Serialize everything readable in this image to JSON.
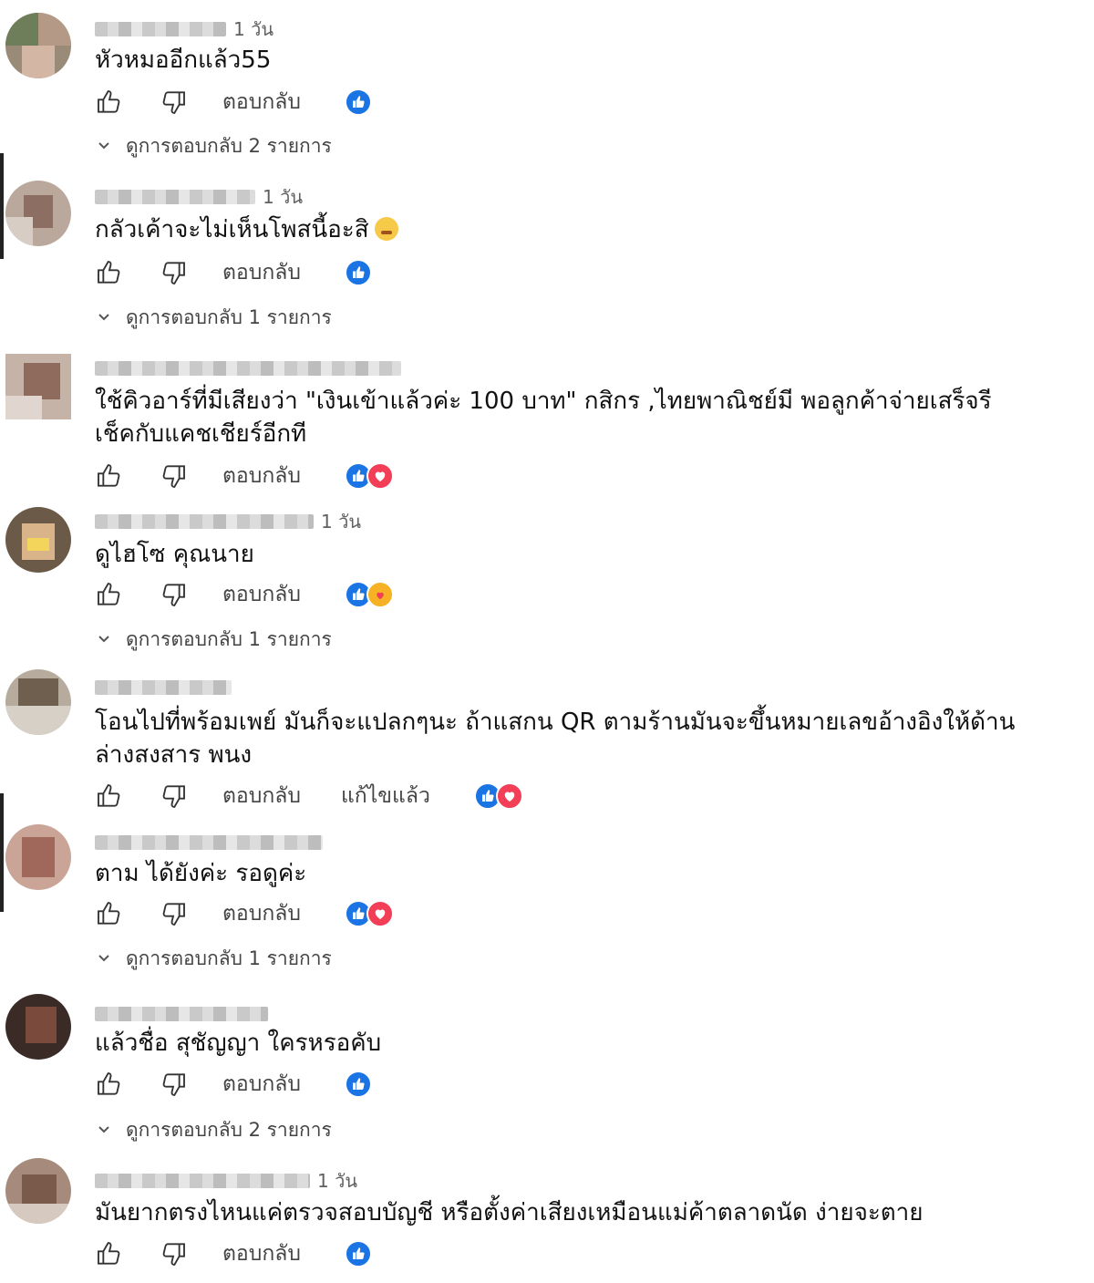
{
  "ui": {
    "reply_label": "ตอบกลับ",
    "edited_label": "แก้ไขแล้ว"
  },
  "colors": {
    "like": "#1b74e4",
    "love": "#f33e58",
    "care": "#f7b125",
    "text": "#111111",
    "muted": "#606060"
  },
  "comments": [
    {
      "time": "1 วัน",
      "text": "หัวหมออีกแล้ว55",
      "reactions": [
        "like-icon"
      ],
      "replies": "ดูการตอบกลับ 2 รายการ"
    },
    {
      "time": "1 วัน",
      "text": "กลัวเค้าจะไม่เห็นโพสนี้อะสิ",
      "emoji": "sad-face-emoji",
      "reactions": [
        "like-icon"
      ],
      "replies": "ดูการตอบกลับ 1 รายการ"
    },
    {
      "time": "",
      "text": "ใช้คิวอาร์ที่มีเสียงว่า \"เงินเข้าแล้วค่ะ 100 บาท\" กสิกร ,ไทยพาณิชย์มี พอลูกค้าจ่ายเสร็จรีเช็คกับแคชเชียร์อีกที",
      "reactions": [
        "like-icon",
        "love-icon"
      ],
      "replies": ""
    },
    {
      "time": "1 วัน",
      "text": "ดูไฮโซ คุณนาย",
      "reactions": [
        "like-icon",
        "care-icon"
      ],
      "replies": "ดูการตอบกลับ 1 รายการ"
    },
    {
      "time": "",
      "text": "โอนไปที่พร้อมเพย์ มันก็จะแปลกๆนะ ถ้าแสกน QR ตามร้านมันจะขึ้นหมายเลขอ้างอิงให้ด้านล่างสงสาร พนง",
      "edited": true,
      "reactions": [
        "like-icon",
        "love-icon"
      ],
      "replies": ""
    },
    {
      "time": "",
      "text": "ตาม ได้ยังค่ะ รอดูค่ะ",
      "reactions": [
        "like-icon",
        "love-icon"
      ],
      "replies": "ดูการตอบกลับ 1 รายการ"
    },
    {
      "time": "",
      "text": "แล้วชื่อ สุชัญญา ใครหรอคับ",
      "reactions": [
        "like-icon"
      ],
      "replies": "ดูการตอบกลับ 2 รายการ"
    },
    {
      "time": "1 วัน",
      "text": "มันยากตรงไหนแค่ตรวจสอบบัญชี หรือตั้งค่าเสียงเหมือนแม่ค้าตลาดนัด ง่ายจะตาย",
      "reactions": [
        "like-icon"
      ],
      "replies": ""
    }
  ]
}
